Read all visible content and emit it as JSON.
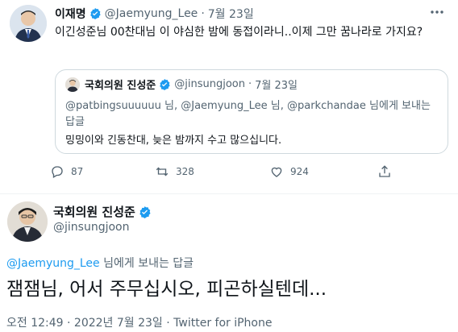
{
  "tweet": {
    "author_name": "이재명",
    "author_handle": "@Jaemyung_Lee",
    "separator": "·",
    "date": "7월 23일",
    "text": "이긴성준님 00찬대님 이 야심한 밤에 동접이라니..이제 그만 꿈나라로 가지요?",
    "avatar_icon": "person-avatar-icon",
    "more_icon": "more-icon"
  },
  "quoted_tweet": {
    "author_name": "국회의원 진성준",
    "author_handle": "@jinsungjoon",
    "separator": "·",
    "date": "7월 23일",
    "reply_line": "@patbingsuuuuuu 님, @Jaemyung_Lee 님, @parkchandae 님에게 보내는 답글",
    "text": "밍밍이와 긴동찬대, 늦은 밤까지 수고 많으십니다."
  },
  "actions": {
    "replies": "87",
    "retweets": "328",
    "likes": "924",
    "icons": [
      "reply-icon",
      "retweet-icon",
      "like-icon",
      "share-icon"
    ]
  },
  "reply_tweet": {
    "author_name": "국회의원 진성준",
    "author_handle": "@jinsungjoon",
    "reply_to_mention": "@Jaemyung_Lee",
    "reply_to_suffix": " 님에게 보내는 답글",
    "text": "잼잼님, 어서 주무십시오, 피곤하실텐데...",
    "meta": "오전 12:49 · 2022년 7월 23일 · Twitter for iPhone"
  },
  "colors": {
    "accent": "#1d9bf0",
    "muted": "#536471",
    "text": "#0f1419",
    "border": "#cfd9de"
  }
}
